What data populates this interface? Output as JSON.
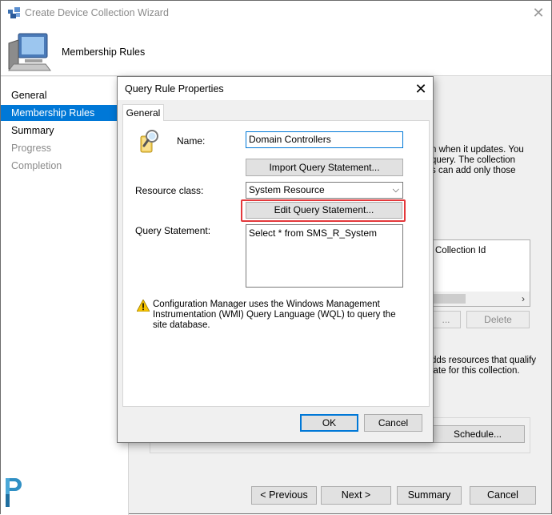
{
  "wizard": {
    "title": "Create Device Collection Wizard",
    "header": "Membership Rules",
    "nav": [
      {
        "label": "General",
        "state": "normal"
      },
      {
        "label": "Membership Rules",
        "state": "active"
      },
      {
        "label": "Summary",
        "state": "normal"
      },
      {
        "label": "Progress",
        "state": "disabled"
      },
      {
        "label": "Completion",
        "state": "disabled"
      }
    ],
    "background_text": {
      "line1": "n when it updates. You",
      "line2": "query. The collection",
      "line3": "s can add only those",
      "collection_id_header": "Collection Id",
      "delete_button": "Delete",
      "line4": "dds resources that qualify",
      "line5": "late for this collection.",
      "schedule_button": "Schedule..."
    },
    "buttons": {
      "previous": "< Previous",
      "next": "Next >",
      "summary": "Summary",
      "cancel": "Cancel"
    }
  },
  "dialog": {
    "title": "Query Rule Properties",
    "tab": "General",
    "name_label": "Name:",
    "name_value": "Domain Controllers",
    "import_button": "Import Query Statement...",
    "resource_class_label": "Resource class:",
    "resource_class_value": "System Resource",
    "edit_button": "Edit Query Statement...",
    "query_statement_label": "Query Statement:",
    "query_statement_value": "Select * from SMS_R_System",
    "info_text": "Configuration Manager uses the Windows Management Instrumentation (WMI) Query Language (WQL) to query the site database.",
    "ok_button": "OK",
    "cancel_button": "Cancel"
  },
  "colors": {
    "accent": "#0078d7",
    "highlight": "#e4393c"
  }
}
